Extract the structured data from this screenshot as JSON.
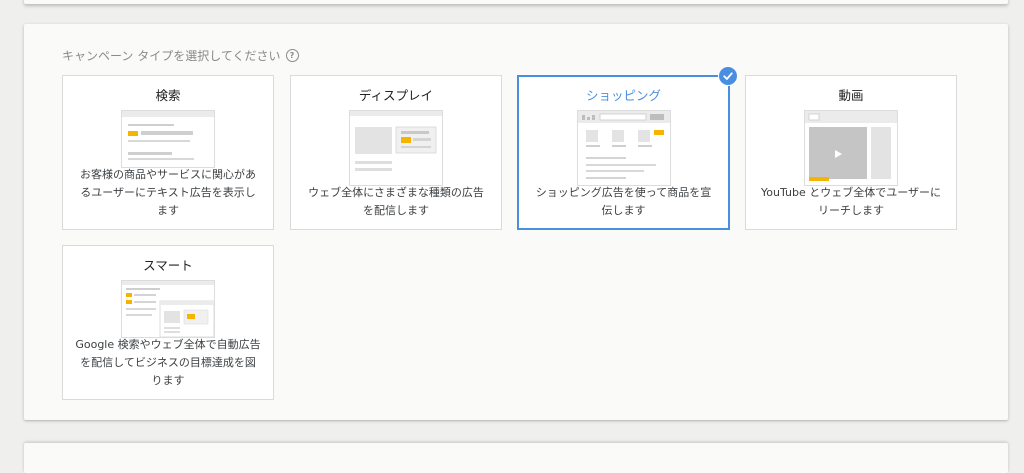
{
  "prompt": {
    "label": "キャンペーン タイプを選択してください",
    "help_icon": "help-circle-icon"
  },
  "campaign_types": {
    "selected": "shopping",
    "search": {
      "title": "検索",
      "desc_lines": [
        "お客様の商品やサービスに関心があ",
        "るユーザーにテキスト広告を表示し",
        "ます"
      ]
    },
    "display": {
      "title": "ディスプレイ",
      "desc_lines": [
        "ウェブ全体にさまざまな種類の広告",
        "を配信します"
      ]
    },
    "shopping": {
      "title": "ショッピング",
      "desc_lines": [
        "ショッピング広告を使って商品を宣",
        "伝します"
      ]
    },
    "video": {
      "title": "動画",
      "desc_lines": [
        "YouTube とウェブ全体でユーザーに",
        "リーチします"
      ]
    },
    "smart": {
      "title": "スマート",
      "desc_lines": [
        "Google 検索やウェブ全体で自動広告",
        "を配信してビジネスの目標達成を図",
        "ります"
      ]
    }
  },
  "colors": {
    "accent": "#4a8fdf",
    "ad_highlight": "#f4b400",
    "background": "#efefed",
    "card": "#fafaf8"
  }
}
